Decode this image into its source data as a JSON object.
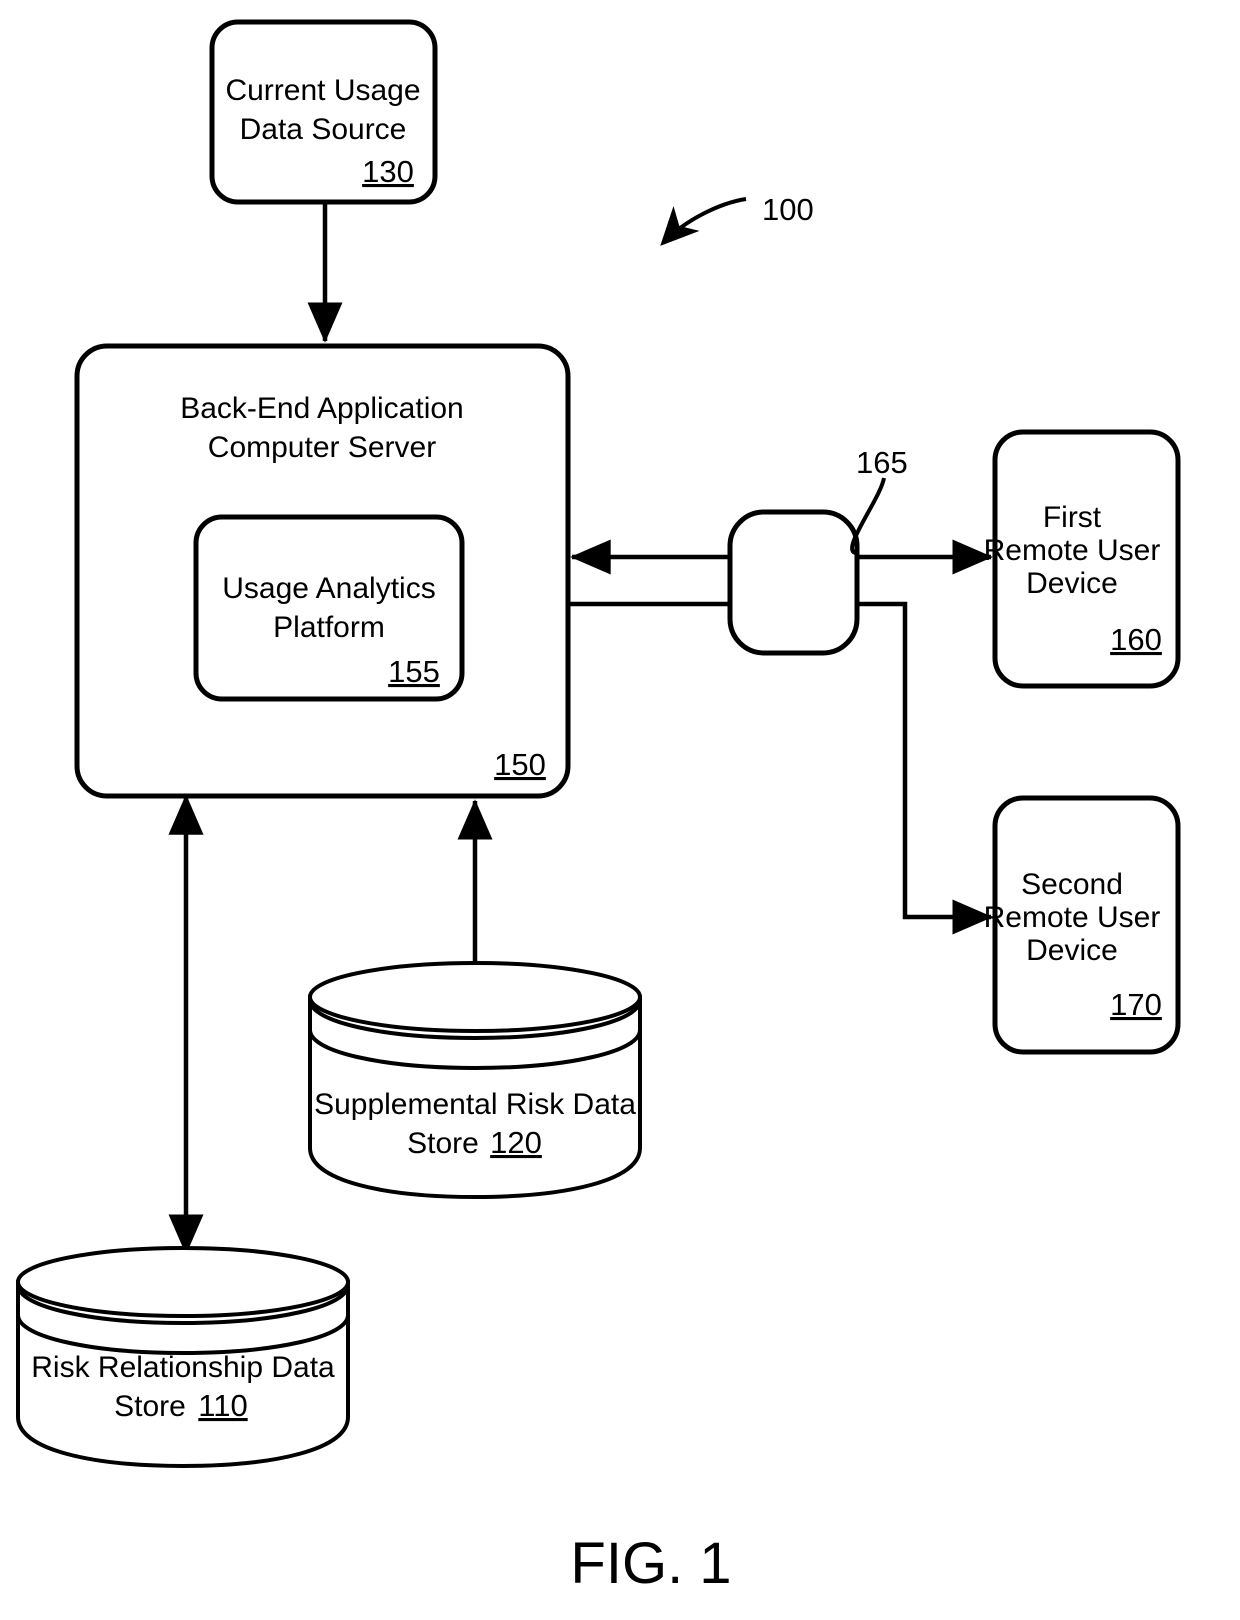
{
  "figure": {
    "caption": "FIG. 1",
    "system_ref": "100"
  },
  "nodes": {
    "current_usage_data_source": {
      "line1": "Current Usage",
      "line2": "Data Source",
      "ref": "130",
      "shape": "rounded-rect"
    },
    "back_end_server": {
      "line1": "Back-End Application",
      "line2": "Computer Server",
      "ref": "150",
      "shape": "rounded-rect"
    },
    "usage_analytics_platform": {
      "line1": "Usage Analytics",
      "line2": "Platform",
      "ref": "155",
      "shape": "rounded-rect"
    },
    "network": {
      "ref": "165",
      "shape": "rounded-rect-vertical"
    },
    "first_remote_user_device": {
      "line1": "First",
      "line2": "Remote User",
      "line3": "Device",
      "ref": "160",
      "shape": "rounded-rect"
    },
    "second_remote_user_device": {
      "line1": "Second",
      "line2": "Remote User",
      "line3": "Device",
      "ref": "170",
      "shape": "rounded-rect"
    },
    "supplemental_risk_data_store": {
      "line1": "Supplemental Risk Data",
      "line2": "Store",
      "ref": "120",
      "shape": "cylinder"
    },
    "risk_relationship_data_store": {
      "line1": "Risk Relationship Data",
      "line2": "Store",
      "ref": "110",
      "shape": "cylinder"
    }
  },
  "connectors": [
    {
      "name": "source-to-server",
      "from": "current_usage_data_source",
      "to": "back_end_server",
      "arrows": "single-down"
    },
    {
      "name": "server-to-network-to-first",
      "from": "back_end_server",
      "to": "first_remote_user_device",
      "arrows": "double"
    },
    {
      "name": "server-to-second",
      "from": "back_end_server",
      "to": "second_remote_user_device",
      "arrows": "single-right"
    },
    {
      "name": "server-to-risk-relationship",
      "from": "back_end_server",
      "to": "risk_relationship_data_store",
      "arrows": "double-vertical"
    },
    {
      "name": "supplemental-to-server",
      "from": "supplemental_risk_data_store",
      "to": "back_end_server",
      "arrows": "single-up"
    }
  ],
  "colors": {
    "stroke": "#000000",
    "fill": "#ffffff"
  }
}
